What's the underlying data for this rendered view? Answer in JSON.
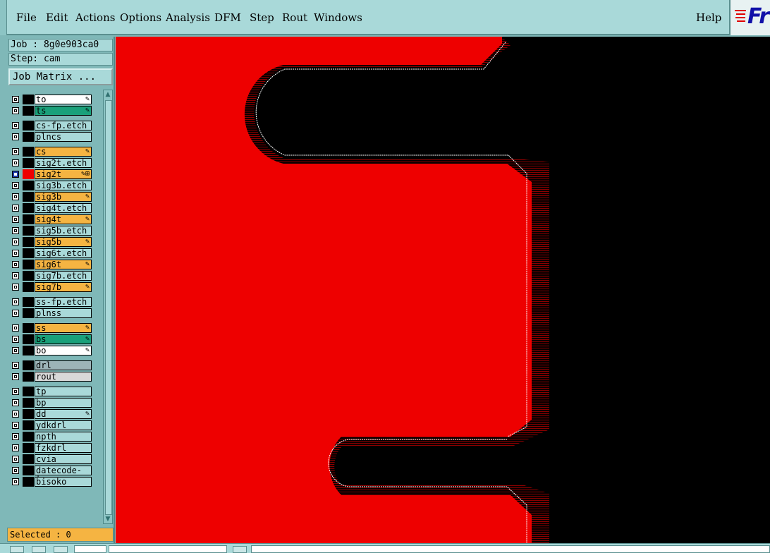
{
  "menubar": {
    "items": [
      {
        "label": "File",
        "hot": "F"
      },
      {
        "label": "Edit",
        "hot": "E"
      },
      {
        "label": "Actions",
        "hot": "A"
      },
      {
        "label": "Options",
        "hot": "O"
      },
      {
        "label": "Analysis",
        "hot": ""
      },
      {
        "label": "DFM",
        "hot": ""
      },
      {
        "label": "Step",
        "hot": "S"
      },
      {
        "label": "Rout",
        "hot": "R"
      },
      {
        "label": "Windows",
        "hot": "W"
      }
    ],
    "help": "Help",
    "logo_text": "Fr"
  },
  "job": {
    "label": "Job : 8g0e903ca0"
  },
  "step": {
    "label": "Step: cam"
  },
  "job_matrix_button": "Job Matrix ...",
  "layers": [
    {
      "name": "to",
      "color": "white",
      "flag": "pen"
    },
    {
      "name": "ts",
      "color": "green",
      "flag": "pen"
    },
    {
      "name": "cs-fp.etch",
      "color": "cyan",
      "flag": ""
    },
    {
      "name": "plncs",
      "color": "cyan",
      "flag": ""
    },
    {
      "name": "cs",
      "color": "orange",
      "flag": "pen"
    },
    {
      "name": "sig2t.etch",
      "color": "cyan",
      "flag": ""
    },
    {
      "name": "sig2t",
      "color": "orange",
      "flag": "pen-lock",
      "selected": true
    },
    {
      "name": "sig3b.etch",
      "color": "cyan",
      "flag": ""
    },
    {
      "name": "sig3b",
      "color": "orange",
      "flag": "pen"
    },
    {
      "name": "sig4t.etch",
      "color": "cyan",
      "flag": ""
    },
    {
      "name": "sig4t",
      "color": "orange",
      "flag": "pen"
    },
    {
      "name": "sig5b.etch",
      "color": "cyan",
      "flag": ""
    },
    {
      "name": "sig5b",
      "color": "orange",
      "flag": "pen"
    },
    {
      "name": "sig6t.etch",
      "color": "cyan",
      "flag": ""
    },
    {
      "name": "sig6t",
      "color": "orange",
      "flag": "pen"
    },
    {
      "name": "sig7b.etch",
      "color": "cyan",
      "flag": ""
    },
    {
      "name": "sig7b",
      "color": "orange",
      "flag": "pen"
    },
    {
      "name": "ss-fp.etch",
      "color": "cyan",
      "flag": ""
    },
    {
      "name": "plnss",
      "color": "cyan",
      "flag": ""
    },
    {
      "name": "ss",
      "color": "orange",
      "flag": "pen"
    },
    {
      "name": "bs",
      "color": "green",
      "flag": "pen"
    },
    {
      "name": "bo",
      "color": "white",
      "flag": "pen"
    },
    {
      "name": "drl",
      "color": "gray",
      "flag": ""
    },
    {
      "name": "rout",
      "color": "lgray",
      "flag": ""
    },
    {
      "name": "tp",
      "color": "cyan",
      "flag": ""
    },
    {
      "name": "bp",
      "color": "cyan",
      "flag": ""
    },
    {
      "name": "dd",
      "color": "cyan",
      "flag": "pen"
    },
    {
      "name": "ydkdrl",
      "color": "cyan",
      "flag": ""
    },
    {
      "name": "npth",
      "color": "cyan",
      "flag": ""
    },
    {
      "name": "fzkdrl",
      "color": "cyan",
      "flag": ""
    },
    {
      "name": "cvia",
      "color": "cyan",
      "flag": ""
    },
    {
      "name": "datecode-to",
      "color": "cyan",
      "flag": ""
    },
    {
      "name": "bisoko",
      "color": "cyan",
      "flag": ""
    }
  ],
  "selected_status": "Selected : 0",
  "colors": {
    "copper": "#ee0000",
    "background": "#000000",
    "panel": "#a9d9d9",
    "active_layer": "#f5b442",
    "hatch": "#b00000"
  },
  "icons": [
    "pen-icon",
    "lock-icon",
    "scroll-up-icon",
    "scroll-down-icon"
  ]
}
